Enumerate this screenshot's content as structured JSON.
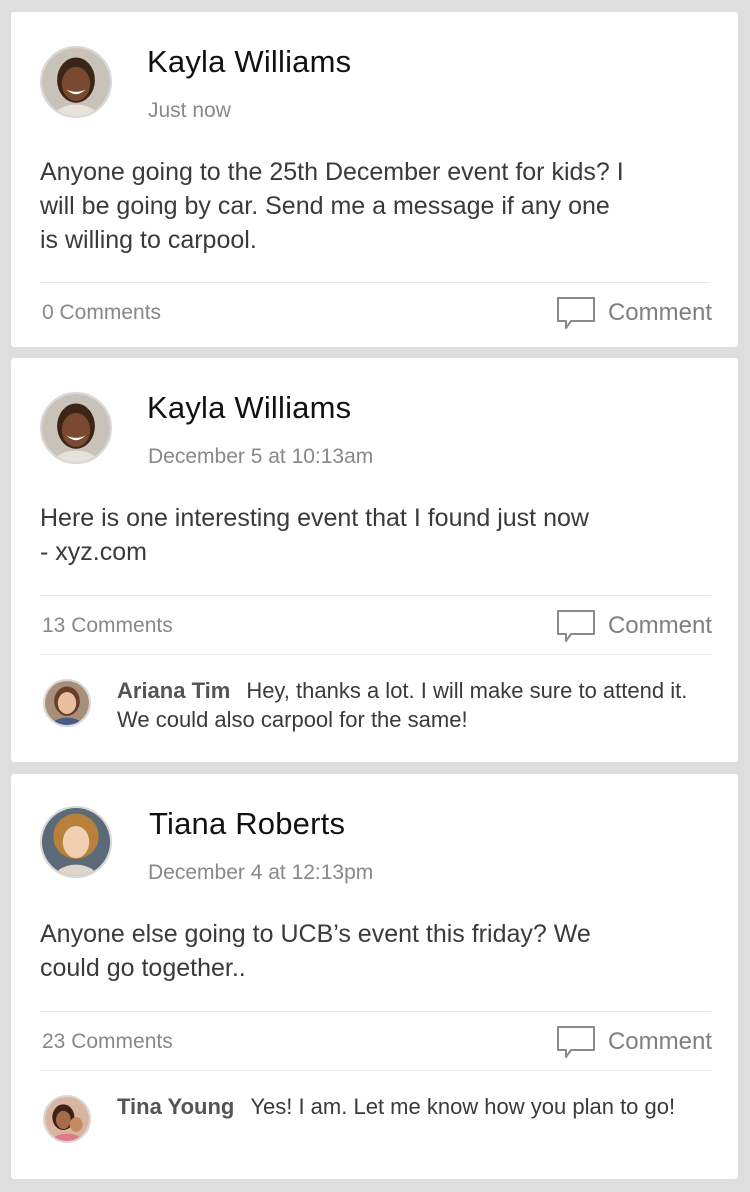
{
  "posts": [
    {
      "author": "Kayla Williams",
      "timestamp": "Just now",
      "body": "Anyone going to the 25th December event for kids? I\nwill be going by car. Send me a message if any one\nis willing to carpool.",
      "comments_count": "0 Comments",
      "comment_label": "Comment"
    },
    {
      "author": "Kayla Williams",
      "timestamp": "December 5 at 10:13am",
      "body": "Here is one interesting event that I found just now\n - xyz.com",
      "comments_count": "13 Comments",
      "comment_label": "Comment",
      "reply": {
        "name": "Ariana Tim",
        "text": "Hey, thanks a lot. I will make sure to attend it. We could also carpool for the same!"
      }
    },
    {
      "author": "Tiana Roberts",
      "timestamp": "December 4 at 12:13pm",
      "body": "Anyone else going to UCB’s event this friday? We\ncould go together..",
      "comments_count": "23 Comments",
      "comment_label": "Comment",
      "reply": {
        "name": "Tina Young",
        "text": "Yes! I am. Let me know how you plan to go!"
      }
    }
  ],
  "icons": {
    "comment": "speech-bubble-icon",
    "avatar": "user-photo"
  },
  "colors": {
    "background": "#dedede",
    "card": "#ffffff",
    "muted_text": "#888888",
    "divider": "#e6e6e6"
  }
}
